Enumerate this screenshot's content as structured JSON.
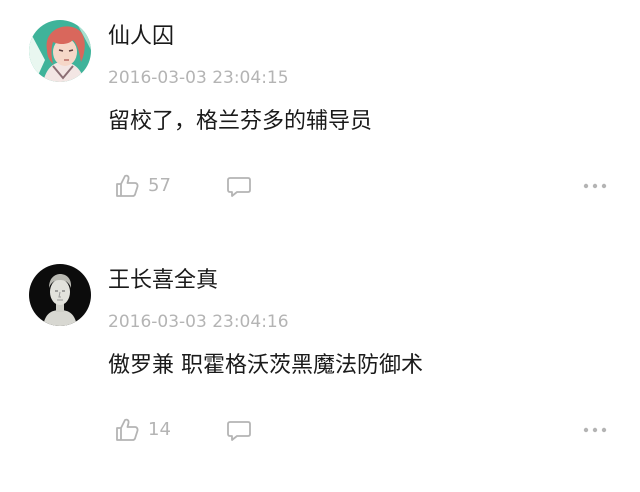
{
  "comments": [
    {
      "username": "仙人囚",
      "timestamp": "2016-03-03 23:04:15",
      "content": "留校了，格兰芬多的辅导员",
      "likes": "57",
      "avatar_icon": "anime-character-avatar-icon"
    },
    {
      "username": "王长喜全真",
      "timestamp": "2016-03-03 23:04:16",
      "content": "傲罗兼 职霍格沃茨黑魔法防御术",
      "likes": "14",
      "avatar_icon": "statue-bust-avatar-icon"
    }
  ],
  "colors": {
    "text_primary": "#1a1a1a",
    "text_secondary": "#b4b4b4",
    "icon": "#b4b4b4"
  }
}
